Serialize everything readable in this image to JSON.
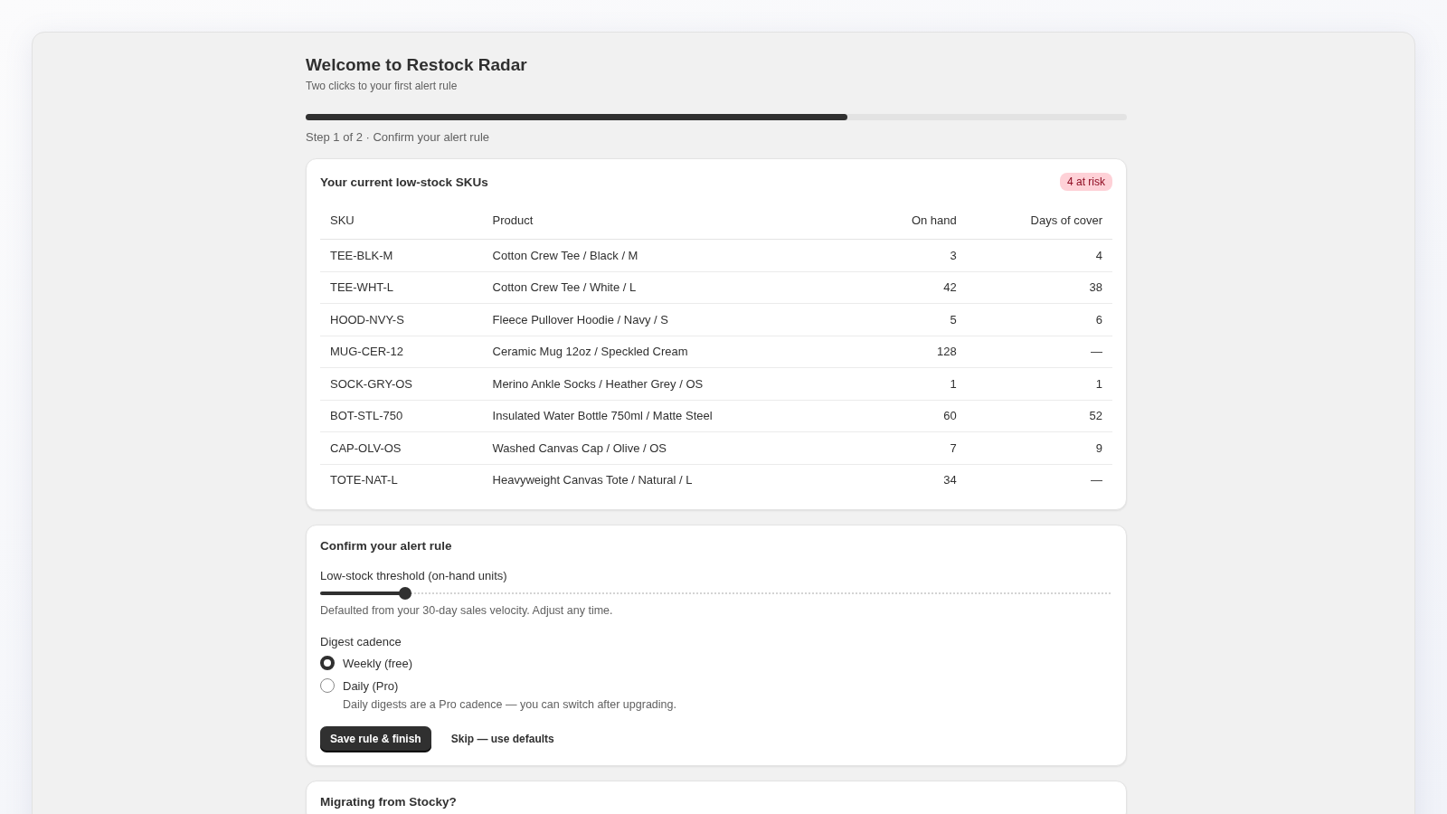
{
  "header": {
    "title": "Welcome to Restock Radar",
    "subtitle": "Two clicks to your first alert rule"
  },
  "progress": {
    "level": 0.66,
    "caption": "Step 1 of 2 · Confirm your alert rule"
  },
  "sku_card": {
    "title": "Your current low-stock SKUs",
    "badge": "4 at risk",
    "columns": [
      "SKU",
      "Product",
      "On hand",
      "Days of cover"
    ],
    "rows": [
      {
        "sku": "TEE-BLK-M",
        "product": "Cotton Crew Tee / Black / M",
        "on_hand": "3",
        "days": "4"
      },
      {
        "sku": "TEE-WHT-L",
        "product": "Cotton Crew Tee / White / L",
        "on_hand": "42",
        "days": "38"
      },
      {
        "sku": "HOOD-NVY-S",
        "product": "Fleece Pullover Hoodie / Navy / S",
        "on_hand": "5",
        "days": "6"
      },
      {
        "sku": "MUG-CER-12",
        "product": "Ceramic Mug 12oz / Speckled Cream",
        "on_hand": "128",
        "days": "—"
      },
      {
        "sku": "SOCK-GRY-OS",
        "product": "Merino Ankle Socks / Heather Grey / OS",
        "on_hand": "1",
        "days": "1"
      },
      {
        "sku": "BOT-STL-750",
        "product": "Insulated Water Bottle 750ml / Matte Steel",
        "on_hand": "60",
        "days": "52"
      },
      {
        "sku": "CAP-OLV-OS",
        "product": "Washed Canvas Cap / Olive / OS",
        "on_hand": "7",
        "days": "9"
      },
      {
        "sku": "TOTE-NAT-L",
        "product": "Heavyweight Canvas Tote / Natural / L",
        "on_hand": "34",
        "days": "—"
      }
    ]
  },
  "rule_card": {
    "title": "Confirm your alert rule",
    "threshold": {
      "label": "Low-stock threshold (on-hand units)",
      "level": 0.107,
      "hint": "Defaulted from your 30-day sales velocity. Adjust any time."
    },
    "cadence": {
      "label": "Digest cadence",
      "options": [
        {
          "label": "Weekly (free)",
          "selected": true
        },
        {
          "label": "Daily (Pro)",
          "selected": false,
          "note": "Daily digests are a Pro cadence — you can switch after upgrading."
        }
      ]
    },
    "primary_button": "Save rule & finish",
    "secondary_link": "Skip — use defaults"
  },
  "migration_card": {
    "title": "Migrating from Stocky?"
  }
}
